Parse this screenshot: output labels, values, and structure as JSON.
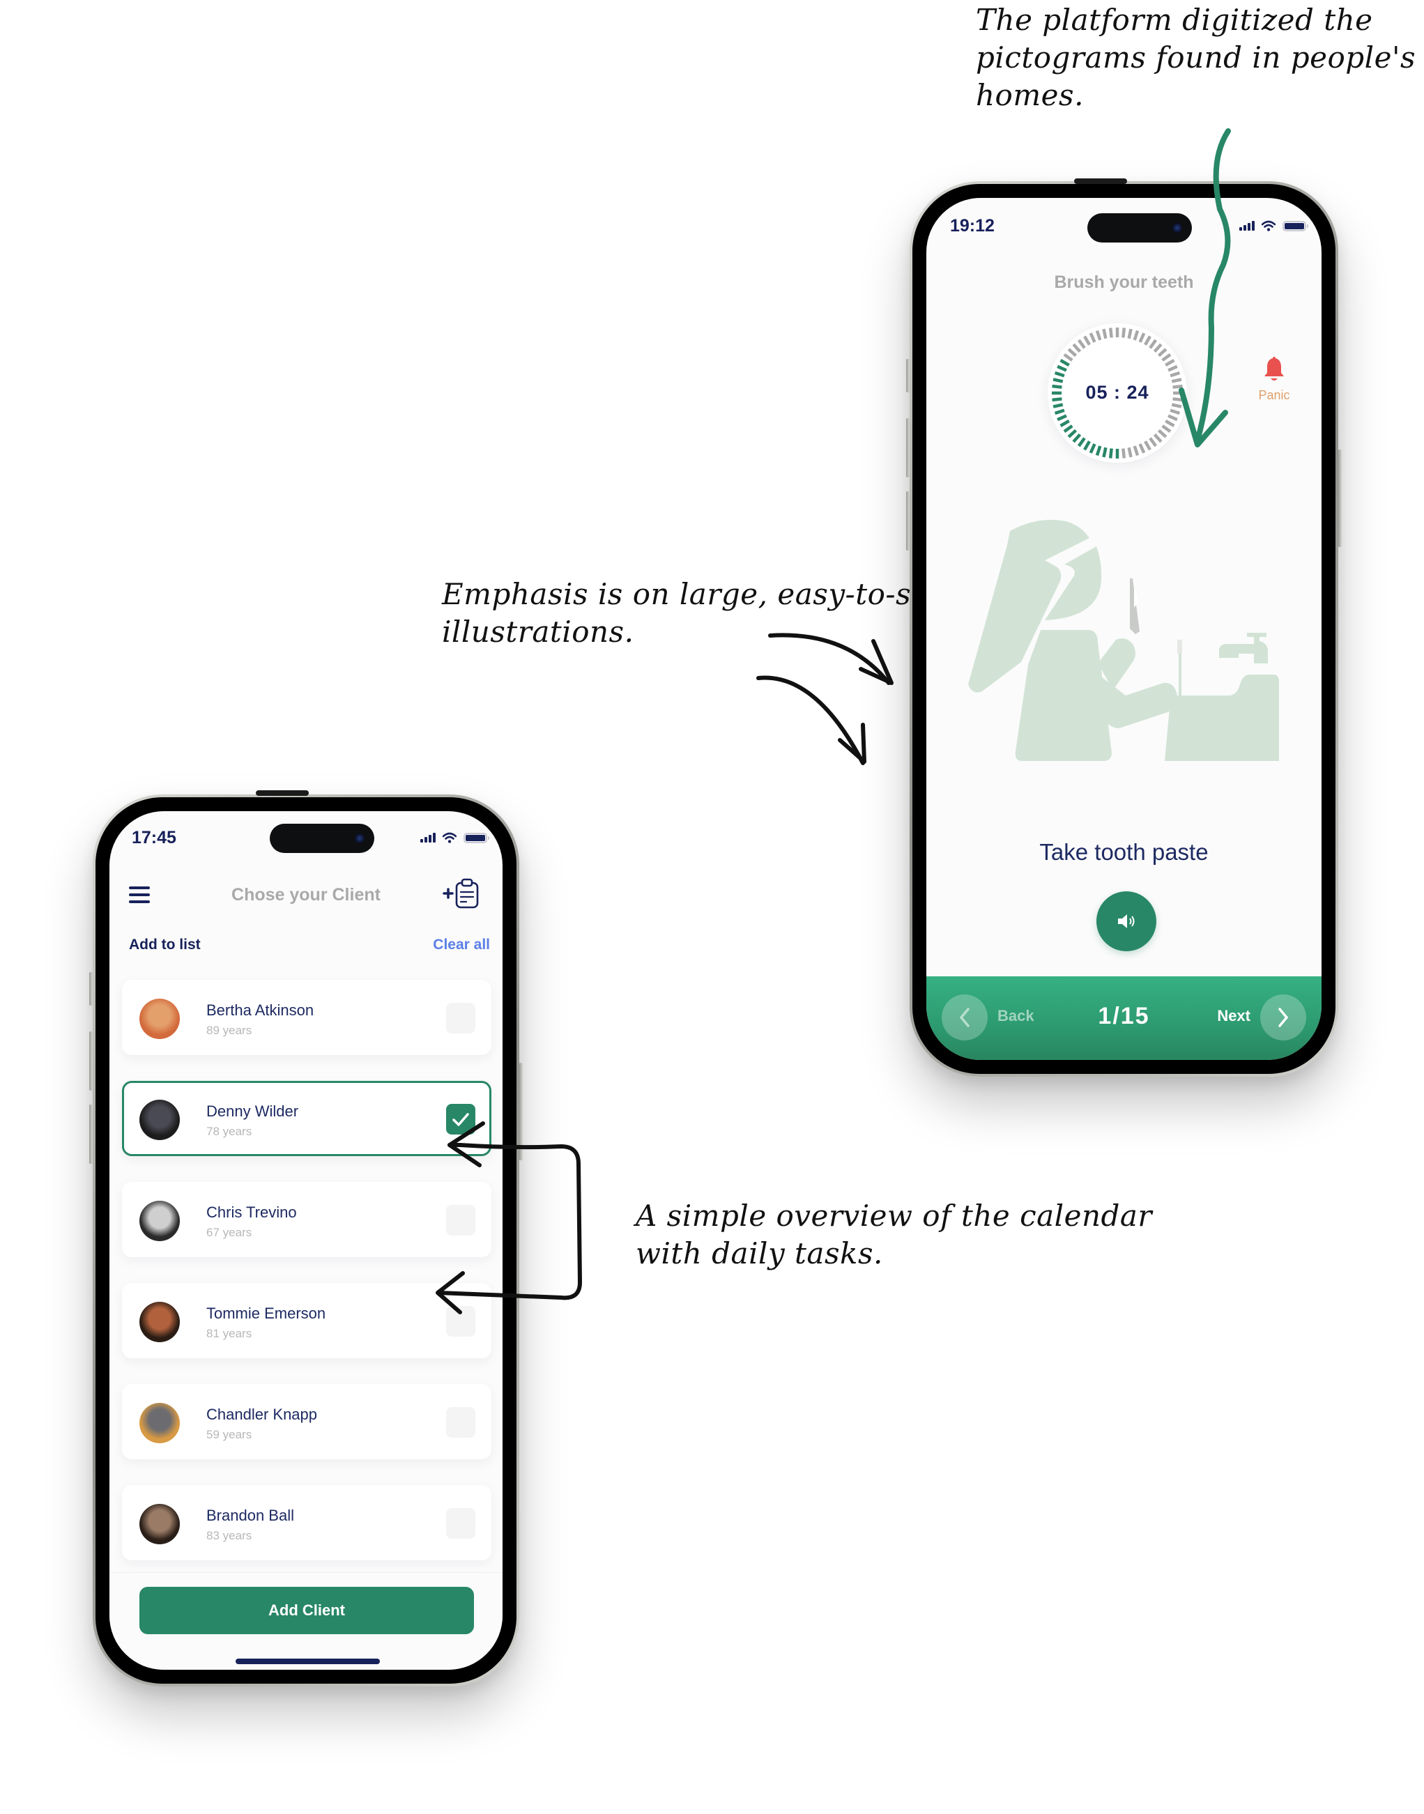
{
  "annotations": {
    "top_right": [
      "The platform digitized the",
      "pictograms found in people's",
      "homes."
    ],
    "middle": [
      "Emphasis is on large, easy-to-see",
      "illustrations."
    ],
    "bottom": [
      "A simple overview of the calendar",
      "with daily tasks."
    ]
  },
  "colors": {
    "brand_green": "#288766",
    "navy": "#17215a",
    "link_blue": "#5b7fe6",
    "panic_red": "#e8514d",
    "illustration_green": "#d2e3d6"
  },
  "task_screen": {
    "status_time": "19:12",
    "title": "Brush your teeth",
    "timer": {
      "text": "05 : 24",
      "progress_fraction": 0.35
    },
    "panic": {
      "label": "Panic",
      "icon": "bell-icon"
    },
    "illustration": "person-brushing-teeth-at-sink",
    "step_text": "Take tooth paste",
    "sound_icon": "speaker-icon",
    "nav": {
      "back_label": "Back",
      "counter": "1/15",
      "next_label": "Next"
    }
  },
  "client_screen": {
    "status_time": "17:45",
    "title": "Chose your Client",
    "menu_icon": "hamburger-icon",
    "add_icon": "add-clipboard-icon",
    "section_label": "Add to list",
    "clear_all_label": "Clear all",
    "clients": [
      {
        "name": "Bertha Atkinson",
        "age": "89 years",
        "selected": false
      },
      {
        "name": "Denny Wilder",
        "age": "78 years",
        "selected": true
      },
      {
        "name": "Chris Trevino",
        "age": "67 years",
        "selected": false
      },
      {
        "name": "Tommie Emerson",
        "age": "81 years",
        "selected": false
      },
      {
        "name": "Chandler Knapp",
        "age": "59 years",
        "selected": false
      },
      {
        "name": "Brandon Ball",
        "age": "83 years",
        "selected": false
      }
    ],
    "add_button_label": "Add Client"
  }
}
